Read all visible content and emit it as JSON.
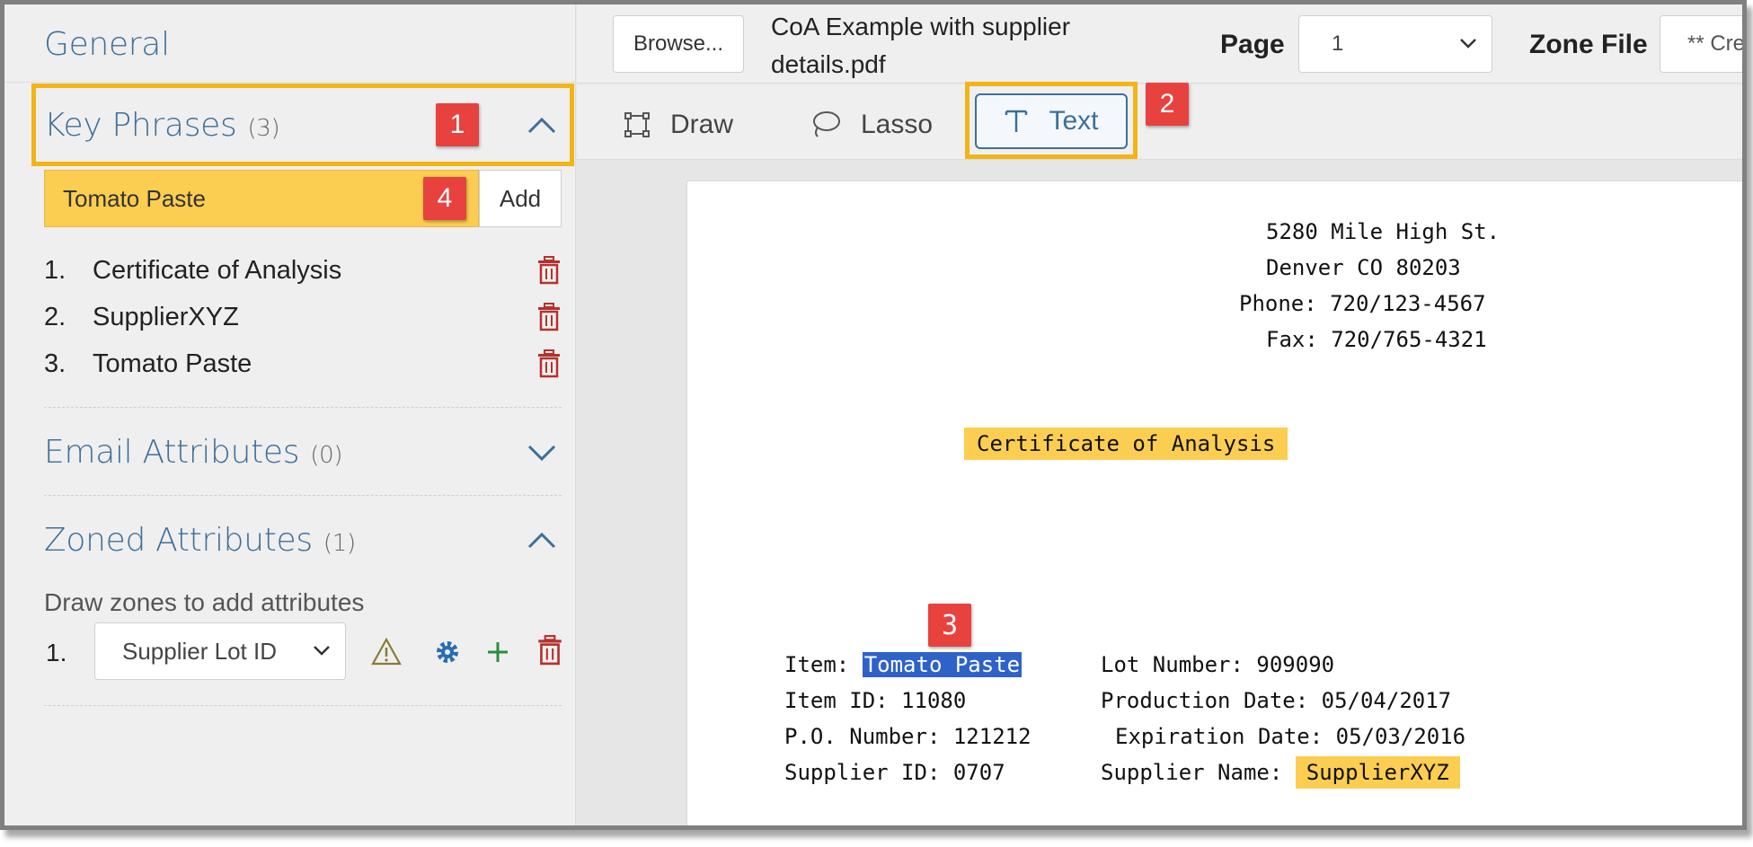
{
  "left_panel": {
    "general_title": "General",
    "key_phrases": {
      "title": "Key Phrases",
      "count": "(3)",
      "input_value": "Tomato Paste",
      "add_label": "Add",
      "items": [
        {
          "num": "1.",
          "text": "Certificate of Analysis"
        },
        {
          "num": "2.",
          "text": "SupplierXYZ"
        },
        {
          "num": "3.",
          "text": "Tomato Paste"
        }
      ]
    },
    "email_attributes": {
      "title": "Email Attributes",
      "count": "(0)"
    },
    "zoned_attributes": {
      "title": "Zoned Attributes",
      "count": "(1)",
      "hint": "Draw zones to add attributes",
      "row_num": "1.",
      "select_value": "Supplier Lot ID"
    }
  },
  "topbar": {
    "browse_label": "Browse...",
    "filename": "CoA Example with supplier details.pdf",
    "page_label": "Page",
    "page_value": "1",
    "zone_file_label": "Zone File",
    "zone_file_value": "** Cre"
  },
  "toolbar": {
    "draw_label": "Draw",
    "lasso_label": "Lasso",
    "text_label": "Text"
  },
  "callouts": {
    "c1": "1",
    "c2": "2",
    "c3": "3",
    "c4": "4"
  },
  "document": {
    "address1": "5280 Mile High St.",
    "address2": "Denver CO 80203",
    "phone": "Phone: 720/123-4567",
    "fax": "Fax: 720/765-4321",
    "title": "Certificate of Analysis",
    "item_label": "Item: ",
    "item_value": "Tomato Paste",
    "lot_number": "Lot Number: 909090",
    "item_id": "Item ID: 11080",
    "production_date": "Production Date: 05/04/2017",
    "po_number": "P.O. Number: 121212",
    "expiration_date": "Expiration Date: 05/03/2016",
    "supplier_id": "Supplier ID: 0707",
    "supplier_name_label": "Supplier Name: ",
    "supplier_name_value": "SupplierXYZ"
  },
  "colors": {
    "accent": "#3d6f99",
    "highlight_yellow": "#fbce52",
    "callout_red": "#e8423f",
    "frame_orange": "#f2b417",
    "selection_blue": "#2e62c9",
    "trash_red": "#b5312d"
  }
}
